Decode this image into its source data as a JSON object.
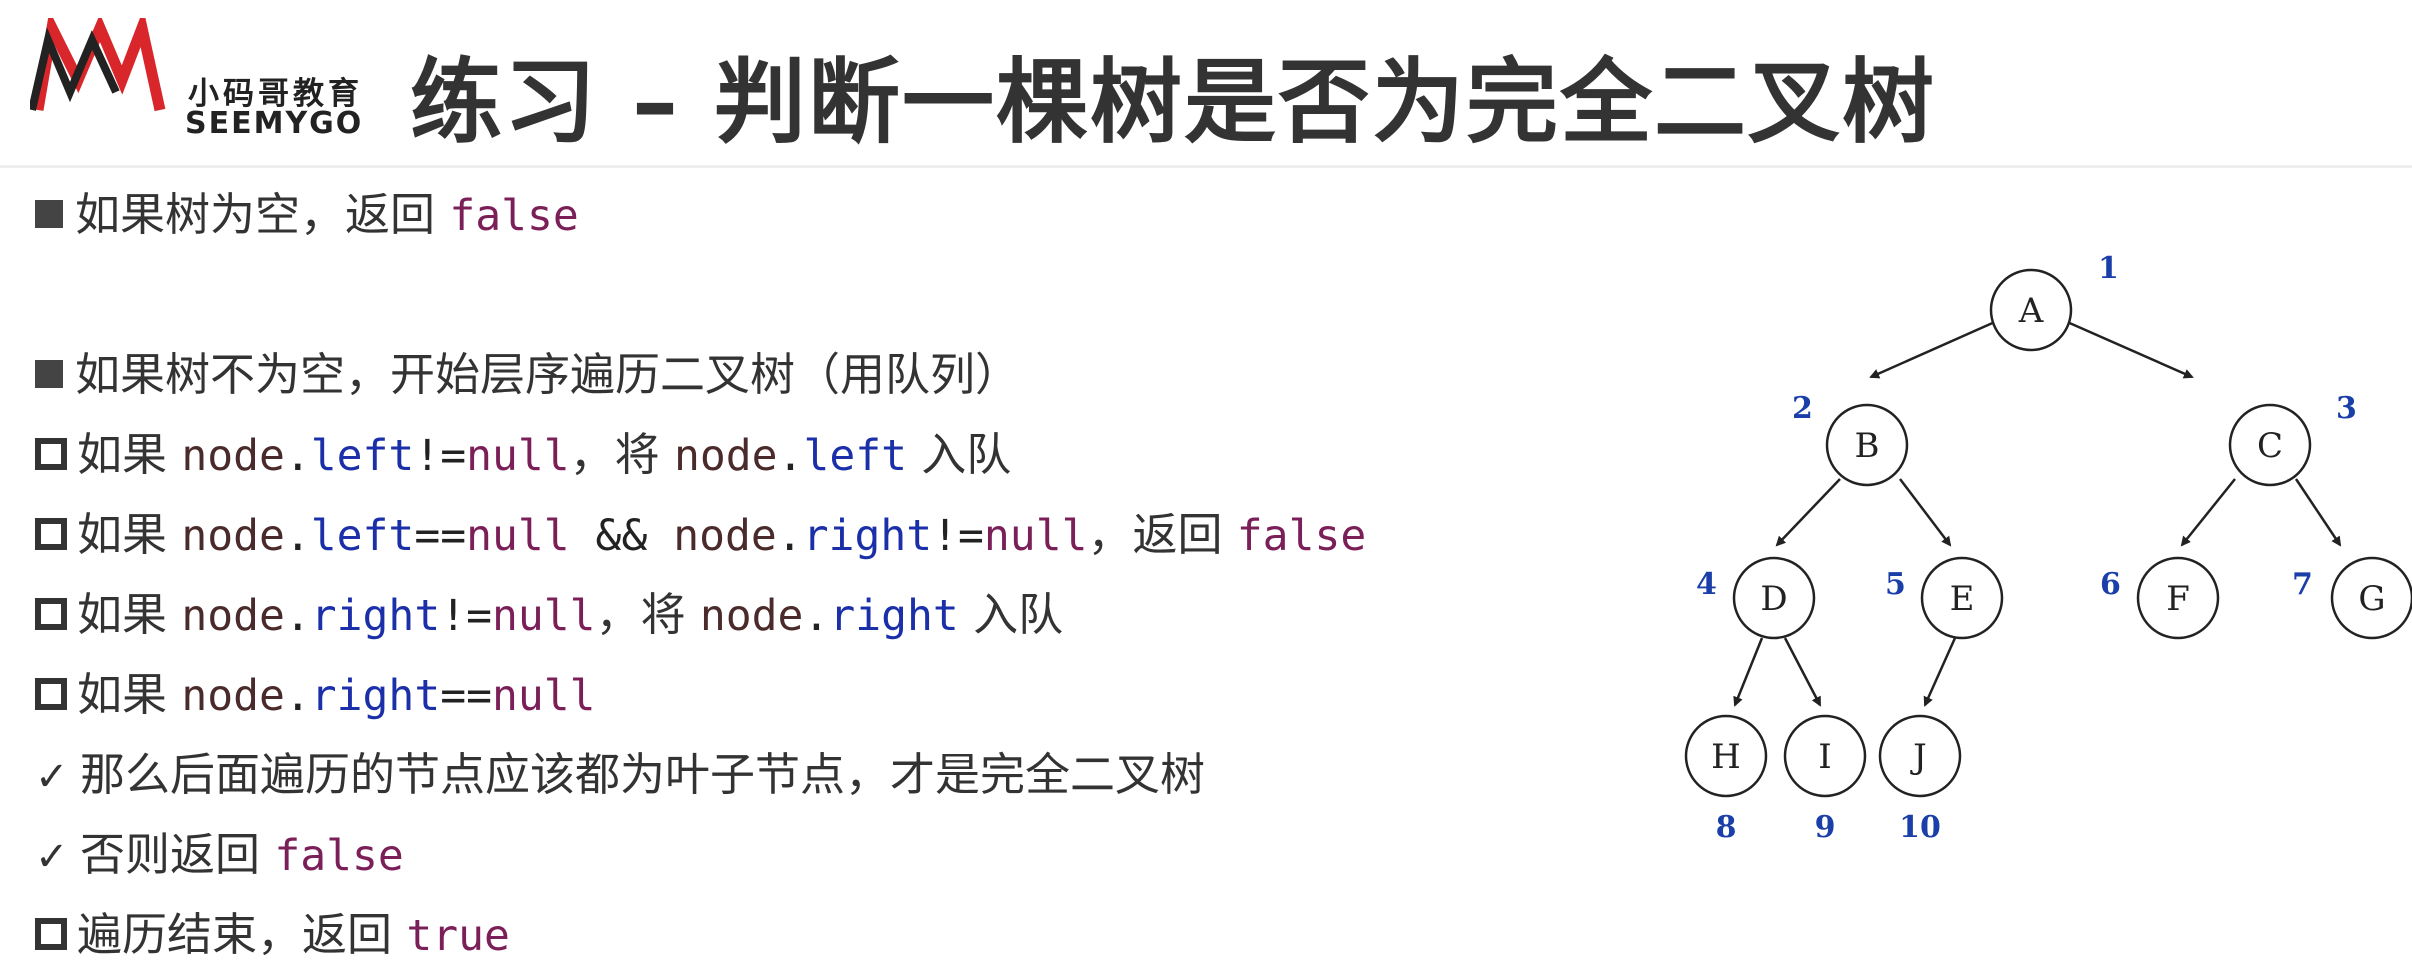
{
  "header": {
    "logo_cn": "小码哥教育",
    "logo_en": "SEEMYGO",
    "title": "练习 – 判断一棵树是否为完全二叉树"
  },
  "bullets": {
    "b1": {
      "text": "如果树为空，返回 ",
      "code": "false"
    },
    "b2": {
      "text": "如果树不为空，开始层序遍历二叉树（用队列）"
    },
    "b3": {
      "pre": "如果 ",
      "node1": "node",
      "dot1": ".",
      "left1": "left",
      "neq1": "!=",
      "null1": "null",
      "mid": "，将 ",
      "node2": "node",
      "dot2": ".",
      "left2": "left",
      "post": " 入队"
    },
    "b4": {
      "pre": "如果 ",
      "node1": "node",
      "dot1": ".",
      "left1": "left",
      "eq": "==",
      "null1": "null",
      "and": " && ",
      "node2": "node",
      "dot2": ".",
      "right": "right",
      "neq": "!=",
      "null2": "null",
      "mid": "，返回 ",
      "false": "false"
    },
    "b5": {
      "pre": "如果 ",
      "node1": "node",
      "dot1": ".",
      "right1": "right",
      "neq": "!=",
      "null1": "null",
      "mid": "，将 ",
      "node2": "node",
      "dot2": ".",
      "right2": "right",
      "post": " 入队"
    },
    "b6": {
      "pre": "如果 ",
      "node": "node",
      "dot": ".",
      "right": "right",
      "eq": "==",
      "null": "null"
    },
    "b7": {
      "text": "那么后面遍历的节点应该都为叶子节点，才是完全二叉树"
    },
    "b8": {
      "text": "否则返回 ",
      "code": "false"
    },
    "b9": {
      "text": "遍历结束，返回 ",
      "code": "true"
    }
  },
  "tree": {
    "nodes": [
      {
        "label": "A",
        "index": "1"
      },
      {
        "label": "B",
        "index": "2"
      },
      {
        "label": "C",
        "index": "3"
      },
      {
        "label": "D",
        "index": "4"
      },
      {
        "label": "E",
        "index": "5"
      },
      {
        "label": "F",
        "index": "6"
      },
      {
        "label": "G",
        "index": "7"
      },
      {
        "label": "H",
        "index": "8"
      },
      {
        "label": "I",
        "index": "9"
      },
      {
        "label": "J",
        "index": "10"
      }
    ]
  },
  "colors": {
    "keyword": "#7a1f57",
    "field": "#1b2fa8",
    "index": "#1b3fa8",
    "text": "#333333"
  }
}
